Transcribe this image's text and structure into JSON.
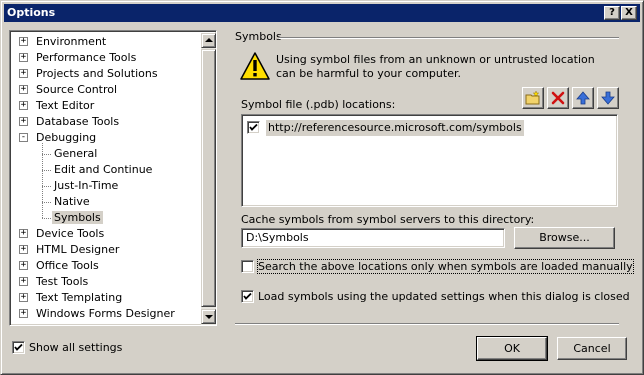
{
  "window": {
    "title": "Options",
    "help_label": "?",
    "close_label": "X"
  },
  "tree": {
    "items": [
      {
        "label": "Environment",
        "level": 0,
        "expander": "+"
      },
      {
        "label": "Performance Tools",
        "level": 0,
        "expander": "+"
      },
      {
        "label": "Projects and Solutions",
        "level": 0,
        "expander": "+"
      },
      {
        "label": "Source Control",
        "level": 0,
        "expander": "+"
      },
      {
        "label": "Text Editor",
        "level": 0,
        "expander": "+"
      },
      {
        "label": "Database Tools",
        "level": 0,
        "expander": "+"
      },
      {
        "label": "Debugging",
        "level": 0,
        "expander": "-"
      },
      {
        "label": "General",
        "level": 1,
        "expander": ""
      },
      {
        "label": "Edit and Continue",
        "level": 1,
        "expander": ""
      },
      {
        "label": "Just-In-Time",
        "level": 1,
        "expander": ""
      },
      {
        "label": "Native",
        "level": 1,
        "expander": ""
      },
      {
        "label": "Symbols",
        "level": 1,
        "expander": "",
        "selected": true
      },
      {
        "label": "Device Tools",
        "level": 0,
        "expander": "+"
      },
      {
        "label": "HTML Designer",
        "level": 0,
        "expander": "+"
      },
      {
        "label": "Office Tools",
        "level": 0,
        "expander": "+"
      },
      {
        "label": "Test Tools",
        "level": 0,
        "expander": "+"
      },
      {
        "label": "Text Templating",
        "level": 0,
        "expander": "+"
      },
      {
        "label": "Windows Forms Designer",
        "level": 0,
        "expander": "+"
      }
    ]
  },
  "show_all_settings": {
    "label": "Show all settings",
    "checked": true
  },
  "symbols": {
    "section_title": "Symbols",
    "warning": "Using symbol files from an unknown or untrusted location can be harmful to your computer.",
    "locations_label": "Symbol file (.pdb) locations:",
    "locations": [
      {
        "url": "http://referencesource.microsoft.com/symbols",
        "checked": true
      }
    ],
    "toolbar_icons": [
      "new-folder-icon",
      "delete-icon",
      "move-up-icon",
      "move-down-icon"
    ],
    "cache_label": "Cache symbols from symbol servers to this directory:",
    "cache_value": "D:\\Symbols",
    "browse_label": "Browse...",
    "search_manual_label": "Search the above locations only when symbols are loaded manually",
    "search_manual_checked": false,
    "load_symbols_label": "Load symbols using the updated settings when this dialog is closed",
    "load_symbols_checked": true
  },
  "buttons": {
    "ok": "OK",
    "cancel": "Cancel"
  }
}
